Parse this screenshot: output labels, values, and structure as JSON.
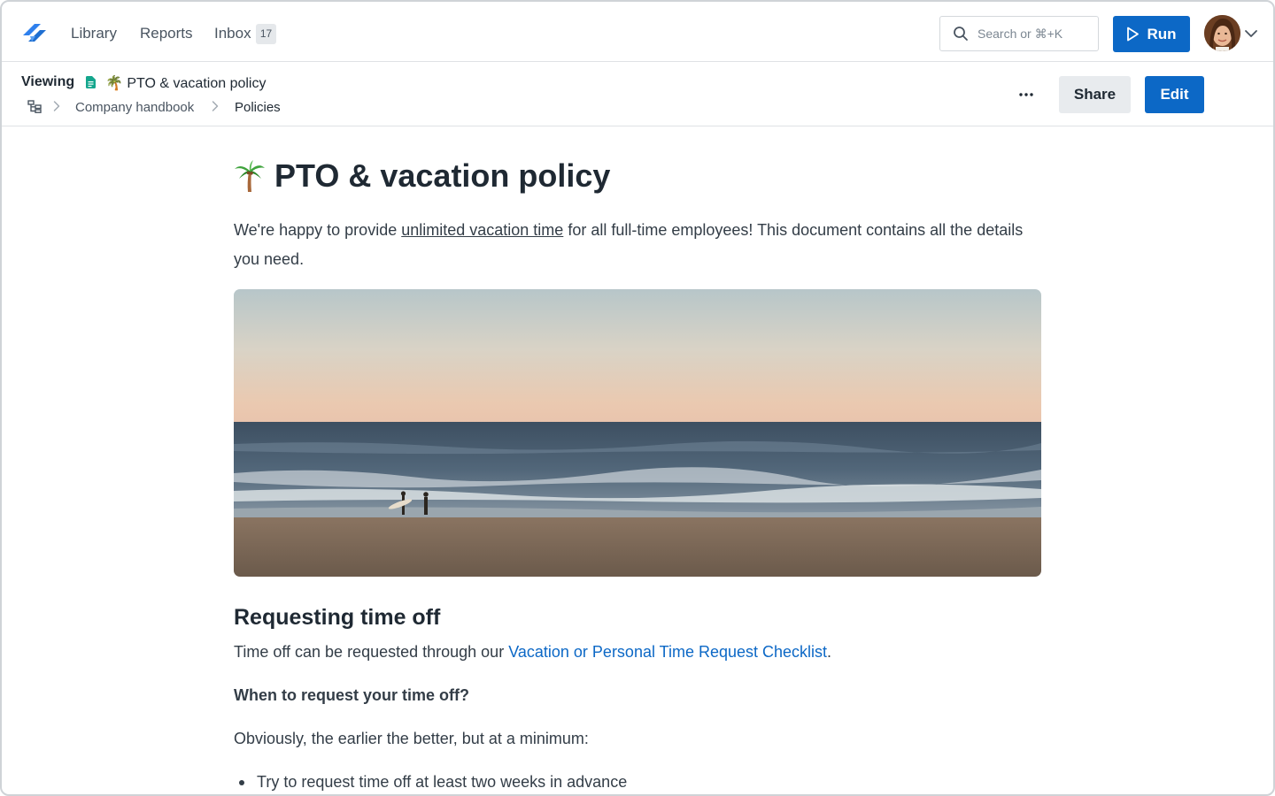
{
  "nav": {
    "library": "Library",
    "reports": "Reports",
    "inbox": "Inbox",
    "inbox_count": "17",
    "search_placeholder": "Search or ⌘+K",
    "run_label": "Run"
  },
  "header": {
    "viewing_label": "Viewing",
    "doc_title": "🌴 PTO & vacation policy",
    "breadcrumb": [
      "Company handbook",
      "Policies"
    ],
    "share_label": "Share",
    "edit_label": "Edit"
  },
  "document": {
    "title_emoji": "🌴",
    "title": "PTO & vacation policy",
    "intro_before": " We're happy to provide ",
    "intro_link": "unlimited vacation time",
    "intro_after": " for all full-time employees! This document contains all the details you need.",
    "section_heading": "Requesting time off",
    "request_before": "Time off can be requested through our ",
    "request_link": "Vacation or Personal Time Request Checklist",
    "request_after": ".",
    "subheading": "When to request your time off?",
    "paragraph": "Obviously, the earlier the better, but at a minimum:",
    "bullets": [
      "Try to request time off at least two weeks in advance"
    ]
  },
  "colors": {
    "accent": "#0c68c6",
    "text": "#1f2933",
    "border": "#dfe2e5"
  },
  "icons": [
    "logo-icon",
    "search-icon",
    "play-icon",
    "chevron-down-icon",
    "doc-icon",
    "tree-icon",
    "chevron-right-icon",
    "more-icon",
    "palm-tree-icon"
  ]
}
